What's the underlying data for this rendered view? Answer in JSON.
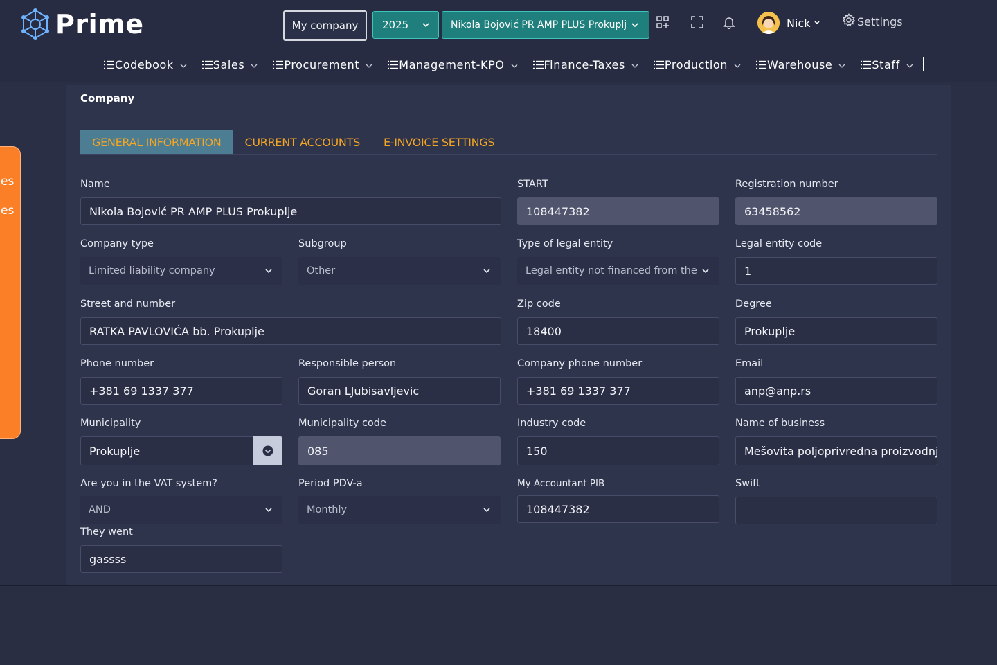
{
  "app": {
    "name": "Prime"
  },
  "header": {
    "my_company": "My company",
    "year": "2025",
    "company_select": "Nikola Bojović PR AMP PLUS Prokuplj",
    "user": "Nick",
    "settings": "Settings"
  },
  "menu": [
    {
      "label": "Codebook"
    },
    {
      "label": "Sales"
    },
    {
      "label": "Procurement"
    },
    {
      "label": "Management-KPO"
    },
    {
      "label": "Finance-Taxes"
    },
    {
      "label": "Production"
    },
    {
      "label": "Warehouse"
    },
    {
      "label": "Staff"
    }
  ],
  "side_tab": {
    "line1": "es",
    "line2": "es"
  },
  "page": {
    "title": "Company",
    "tabs": [
      {
        "label": "GENERAL INFORMATION",
        "active": true
      },
      {
        "label": "CURRENT ACCOUNTS",
        "active": false
      },
      {
        "label": "E-INVOICE SETTINGS",
        "active": false
      }
    ]
  },
  "form": {
    "name": {
      "label": "Name",
      "value": "Nikola Bojović PR  AMP PLUS Prokuplje"
    },
    "start": {
      "label": "START",
      "value": "108447382"
    },
    "registration_number": {
      "label": "Registration number",
      "value": "63458562"
    },
    "company_type": {
      "label": "Company type",
      "value": "Limited liability company"
    },
    "subgroup": {
      "label": "Subgroup",
      "value": "Other"
    },
    "legal_entity_type": {
      "label": "Type of legal entity",
      "value": "Legal entity not financed from the bu"
    },
    "legal_entity_code": {
      "label": "Legal entity code",
      "value": "1"
    },
    "street": {
      "label": "Street and number",
      "value": "RATKA PAVLOVIĆA bb. Prokuplje"
    },
    "zip": {
      "label": "Zip code",
      "value": "18400"
    },
    "degree": {
      "label": "Degree",
      "value": "Prokuplje"
    },
    "phone": {
      "label": "Phone number",
      "value": "+381 69 1337 377"
    },
    "responsible": {
      "label": "Responsible person",
      "value": "Goran LJubisavljevic"
    },
    "company_phone": {
      "label": "Company phone number",
      "value": "+381 69 1337 377"
    },
    "email": {
      "label": "Email",
      "value": "anp@anp.rs"
    },
    "municipality": {
      "label": "Municipality",
      "value": "Prokuplje"
    },
    "municipality_code": {
      "label": "Municipality code",
      "value": "085"
    },
    "industry_code": {
      "label": "Industry code",
      "value": "150"
    },
    "business_name": {
      "label": "Name of business",
      "value": "Mešovita poljoprivredna proizvodnja"
    },
    "vat_system": {
      "label": "Are you in the VAT system?",
      "value": "AND"
    },
    "pdv_period": {
      "label": "Period PDV-a",
      "value": "Monthly"
    },
    "accountant_pib": {
      "label": "My Accountant PIB",
      "value": "108447382"
    },
    "swift": {
      "label": "Swift",
      "value": ""
    },
    "they_went": {
      "label": "They went",
      "value": "gassss"
    }
  },
  "colors": {
    "accent_teal": "#1f7f7c",
    "tab_orange": "#f5a623",
    "side_orange": "#fb7f27",
    "active_tab_bg": "#4d7d93"
  }
}
